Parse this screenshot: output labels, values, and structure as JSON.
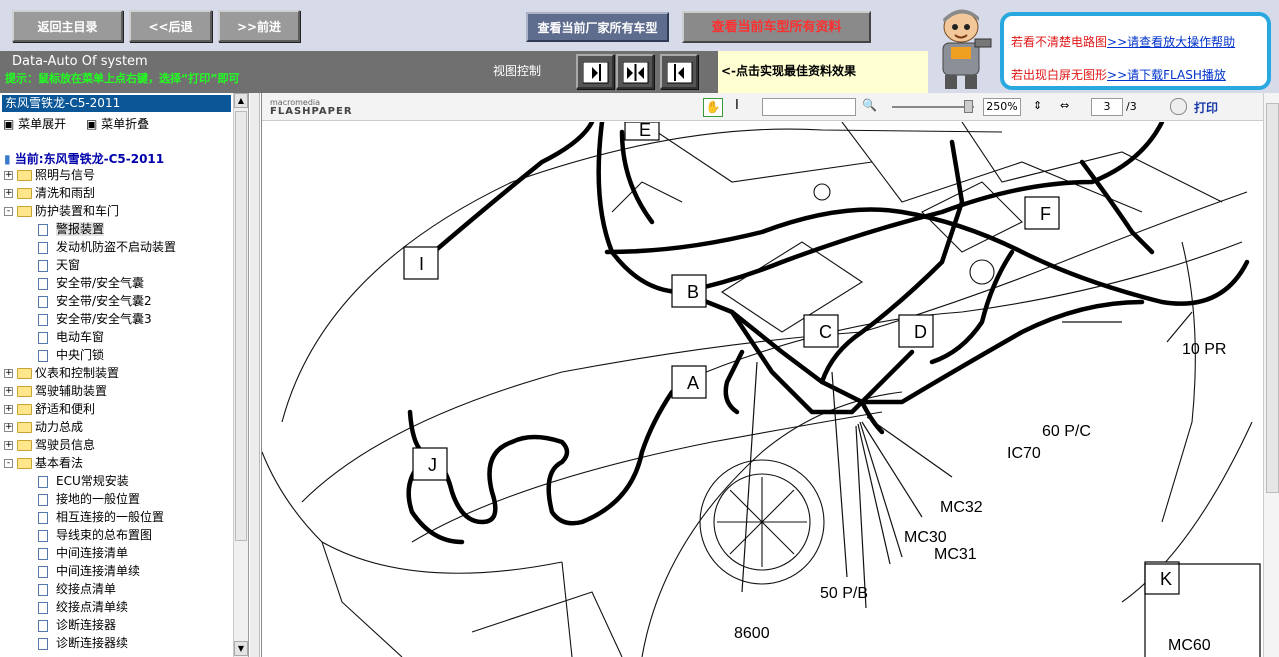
{
  "header": {
    "btn_home": "返回主目录",
    "btn_back": "<<后退",
    "btn_forward": ">>前进",
    "btn_all_models": "查看当前厂家所有车型",
    "btn_all_docs": "查看当前车型所有资料",
    "system_name": "Data-Auto Of system",
    "tip": "提示：鼠标放在菜单上点右键，选择“打印”即可",
    "view_control": "视图控制",
    "view_hint": "<-点击实现最佳资料效果",
    "help_line1_text": "若看不清楚电路图",
    "help_line1_link": ">>请查看放大操作帮助",
    "help_line2_text": "若出现白屏无图形",
    "help_line2_link": ">>请下载FLASH播放"
  },
  "sidebar": {
    "title": "东风雪铁龙-C5-2011",
    "expand": "菜单展开",
    "collapse": "菜单折叠",
    "current": "当前:东风雪铁龙-C5-2011",
    "items": [
      {
        "label": "照明与信号",
        "type": "folder",
        "pm": "+"
      },
      {
        "label": "清洗和雨刮",
        "type": "folder",
        "pm": "+"
      },
      {
        "label": "防护装置和车门",
        "type": "folder",
        "pm": "-"
      },
      {
        "label": "警报装置",
        "type": "leaf",
        "selected": true
      },
      {
        "label": "发动机防盗不启动装置",
        "type": "leaf"
      },
      {
        "label": "天窗",
        "type": "leaf"
      },
      {
        "label": "安全带/安全气囊",
        "type": "leaf"
      },
      {
        "label": "安全带/安全气囊2",
        "type": "leaf"
      },
      {
        "label": "安全带/安全气囊3",
        "type": "leaf"
      },
      {
        "label": "电动车窗",
        "type": "leaf"
      },
      {
        "label": "中央门锁",
        "type": "leaf"
      },
      {
        "label": "仪表和控制装置",
        "type": "folder",
        "pm": "+"
      },
      {
        "label": "驾驶辅助装置",
        "type": "folder",
        "pm": "+"
      },
      {
        "label": "舒适和便利",
        "type": "folder",
        "pm": "+"
      },
      {
        "label": "动力总成",
        "type": "folder",
        "pm": "+"
      },
      {
        "label": "驾驶员信息",
        "type": "folder",
        "pm": "+"
      },
      {
        "label": "基本看法",
        "type": "folder",
        "pm": "-"
      },
      {
        "label": "ECU常规安装",
        "type": "leaf"
      },
      {
        "label": "接地的一般位置",
        "type": "leaf"
      },
      {
        "label": "相互连接的一般位置",
        "type": "leaf"
      },
      {
        "label": "导线束的总布置图",
        "type": "leaf"
      },
      {
        "label": "中间连接清单",
        "type": "leaf"
      },
      {
        "label": "中间连接清单续",
        "type": "leaf"
      },
      {
        "label": "绞接点清单",
        "type": "leaf"
      },
      {
        "label": "绞接点清单续",
        "type": "leaf"
      },
      {
        "label": "诊断连接器",
        "type": "leaf"
      },
      {
        "label": "诊断连接器续",
        "type": "leaf"
      }
    ]
  },
  "viewer": {
    "logo_top": "macromedia",
    "logo_bottom": "FLASHPAPER",
    "zoom": "250%",
    "page": "3",
    "page_total": "/3",
    "print": "打印"
  },
  "diagram": {
    "letters": [
      "E",
      "I",
      "B",
      "C",
      "D",
      "F",
      "A",
      "J",
      "K"
    ],
    "callouts": [
      "10 PR",
      "60 P/C",
      "IC70",
      "MC32",
      "MC30",
      "MC31",
      "50 P/B",
      "8600",
      "MC60"
    ]
  }
}
